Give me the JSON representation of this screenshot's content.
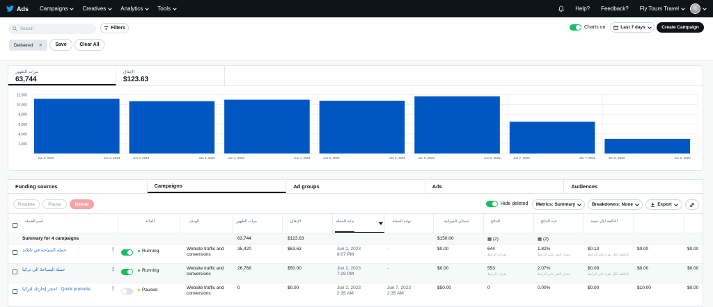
{
  "nav": {
    "logo": "Ads",
    "items": [
      "Campaigns",
      "Creatives",
      "Analytics",
      "Tools"
    ],
    "help": "Help?",
    "feedback": "Feedback?",
    "account": "Fly Tours Travel"
  },
  "toolbar": {
    "search_placeholder": "Search",
    "filters": "Filters",
    "charts_on": "Charts on",
    "date_range": "Last 7 days",
    "create": "Create Campaign",
    "chip": "Delivered",
    "save": "Save",
    "clear": "Clear All"
  },
  "metrics": [
    {
      "label": "مرات الظهور",
      "value": "63,744"
    },
    {
      "label": "الإنفاق",
      "value": "$123.63"
    }
  ],
  "chart_data": {
    "type": "bar",
    "x": [
      "Jun 2, 2023",
      "Jun 3, 2023",
      "Jun 4, 2023",
      "Jun 5, 2023",
      "Jun 6, 2023",
      "Jun 7, 2023",
      "Jun 8, 2023"
    ],
    "tick_labels": [
      "Jun 2, 2023",
      "Jun 2, 2023",
      "Jun 3, 2023",
      "Jun 3, 2023",
      "Jun 4, 2023",
      "Jun 4, 2023",
      "Jun 5, 2023",
      "Jun 5, 2023",
      "Jun 6, 2023",
      "Jun 6, 2023",
      "Jun 7, 2023",
      "Jun 7, 2023",
      "Jun 8, 2023",
      "Jun 8, 2023"
    ],
    "values": [
      11200,
      10700,
      11000,
      10800,
      11700,
      6500,
      3000
    ],
    "yticks": [
      "12,000",
      "10,000",
      "8,000",
      "6,000",
      "4,000",
      "2,000"
    ],
    "ylim": [
      0,
      12500
    ],
    "color": "#0057c2",
    "grid": true
  },
  "tabs": [
    "Funding sources",
    "Campaigns",
    "Ad groups",
    "Ads",
    "Audiences"
  ],
  "actions": {
    "resume": "Resume",
    "pause": "Pause",
    "delete": "Delete",
    "hide_deleted": "Hide deleted",
    "metrics": "Metrics: Summary",
    "breakdowns": "Breakdowns: None",
    "export": "Export"
  },
  "table": {
    "headers": [
      "اسم الحملة",
      "الحالة",
      "الهدف",
      "مرات الظهور",
      "الإنفاق",
      "بداية الحملة",
      "نهاية الحملة",
      "إجمالي الميزانية",
      "النتائج",
      "عدد النتائج",
      "التكلفة لكل نتيجة"
    ],
    "summary": [
      "Summary for 4 campaigns",
      "63,744",
      "$123.63",
      "$150.00",
      "(2)",
      "(2)"
    ],
    "rows": [
      {
        "name": "حملة السياحة في تايلاند",
        "status": "Running",
        "objective": "Website traffic and conversions",
        "impressions": "35,420",
        "spend": "$63.63",
        "start": "Jun 2, 2023",
        "start_time": "8:07 PM",
        "end": "-",
        "budget": "$0.00",
        "results": "644",
        "results_sub": "نقرات الرابط",
        "rate": "1.82%",
        "rate_sub": "معدل النقر على الرابط",
        "cost": "$0.10",
        "cost_sub": "التكلفة لكل نقرة على الرابط",
        "c1": "$0.00",
        "c2": "$0.00"
      },
      {
        "name": "حملة السياحة الى تركيا",
        "status": "Running",
        "objective": "Website traffic and conversions",
        "impressions": "26,768",
        "spend": "$50.00",
        "start": "Jun 2, 2023",
        "start_time": "7:29 PM",
        "end": "-",
        "budget": "$0.00",
        "results": "553",
        "results_sub": "نقرات الرابط",
        "rate": "2.07%",
        "rate_sub": "معدل النقر على الرابط",
        "cost": "$0.09",
        "cost_sub": "التكلفة لكل نقرة على الرابط",
        "c1": "$0.00",
        "c2": "$0.00"
      },
      {
        "name": "Quick promote : احجز إجازتك لتركيا",
        "status": "Paused",
        "objective": "Website traffic and conversions",
        "impressions": "0",
        "spend": "$0.00",
        "start": "Jun 2, 2023",
        "start_time": "2:35 AM",
        "end": "Jun 7, 2023",
        "end_time": "2:35 AM",
        "budget": "$50.00",
        "results": "0",
        "results_sub": "",
        "rate": "0.00%",
        "rate_sub": "",
        "cost": "$0.00",
        "cost_sub": "",
        "c1": "$10.00",
        "c2": "$0.00"
      }
    ]
  }
}
